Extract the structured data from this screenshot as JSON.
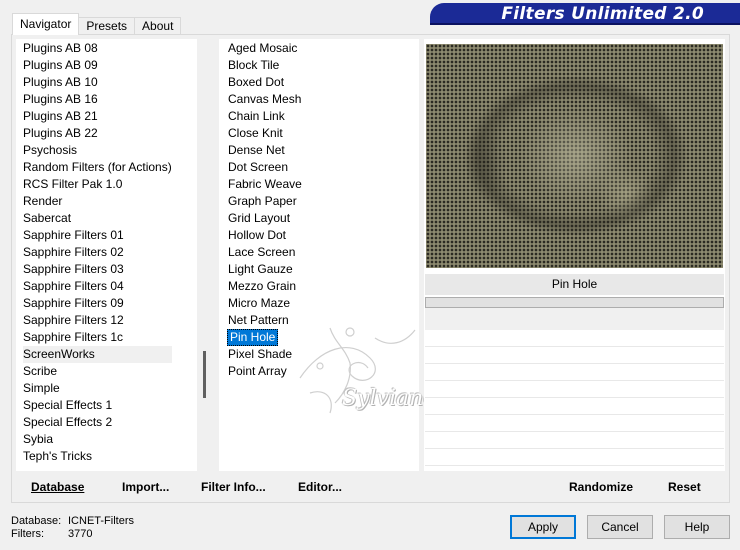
{
  "tabs": [
    "Navigator",
    "Presets",
    "About"
  ],
  "banner_title": "Filters Unlimited 2.0",
  "categories": [
    "Plugins AB 08",
    "Plugins AB 09",
    "Plugins AB 10",
    "Plugins AB 16",
    "Plugins AB 21",
    "Plugins AB 22",
    "Psychosis",
    "Random Filters (for Actions)",
    "RCS Filter Pak 1.0",
    "Render",
    "Sabercat",
    "Sapphire Filters 01",
    "Sapphire Filters 02",
    "Sapphire Filters 03",
    "Sapphire Filters 04",
    "Sapphire Filters 09",
    "Sapphire Filters 12",
    "Sapphire Filters 1c",
    "ScreenWorks",
    "Scribe",
    "Simple",
    "Special Effects 1",
    "Special Effects 2",
    "Sybia",
    "Teph's Tricks"
  ],
  "selected_category": "ScreenWorks",
  "filters": [
    "Aged Mosaic",
    "Block Tile",
    "Boxed Dot",
    "Canvas Mesh",
    "Chain Link",
    "Close Knit",
    "Dense Net",
    "Dot Screen",
    "Fabric Weave",
    "Graph Paper",
    "Grid Layout",
    "Hollow Dot",
    "Lace Screen",
    "Light Gauze",
    "Mezzo Grain",
    "Micro Maze",
    "Net Pattern",
    "Pin Hole",
    "Pixel Shade",
    "Point Array"
  ],
  "selected_filter": "Pin Hole",
  "filter_name_display": "Pin Hole",
  "watermark_text": "Sylviane",
  "toolbar": {
    "database": "Database",
    "import": "Import...",
    "filter_info": "Filter Info...",
    "editor": "Editor...",
    "randomize": "Randomize",
    "reset": "Reset"
  },
  "status": {
    "database_label": "Database:",
    "database_value": "ICNET-Filters",
    "filters_label": "Filters:",
    "filters_value": "3770"
  },
  "buttons": {
    "apply": "Apply",
    "cancel": "Cancel",
    "help": "Help"
  },
  "colors": {
    "banner": "#1b2a96",
    "selection": "#0078d7"
  }
}
